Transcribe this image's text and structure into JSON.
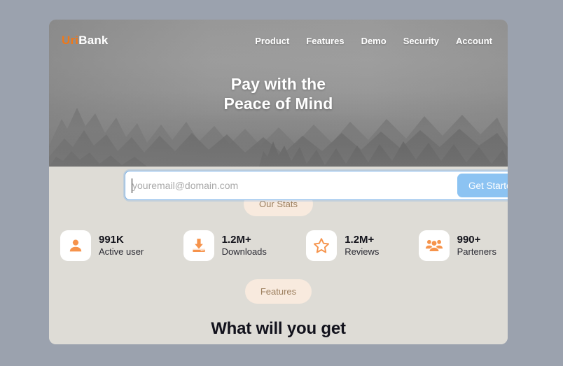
{
  "theme": {
    "page_background": "#9ba2ae",
    "card_background": "#dedcd6",
    "accent_orange": "#f07818",
    "icon_orange": "#f6934b",
    "button_blue": "#8cc3f2",
    "pill_background": "#f8eade",
    "pill_text": "#9c7f5e"
  },
  "header": {
    "logo": {
      "icon": "none",
      "part_one": "Uri",
      "part_two": "Bank",
      "full": "UriBank"
    },
    "nav": [
      {
        "label": "Product"
      },
      {
        "label": "Features"
      },
      {
        "label": "Demo"
      },
      {
        "label": "Security"
      },
      {
        "label": "Account"
      }
    ]
  },
  "hero": {
    "headline_line_1": "Pay with the",
    "headline_line_2": "Peace of Mind",
    "background_description": "grayscale misty forest photograph"
  },
  "signup": {
    "placeholder": "youremail@domain.com",
    "value": "",
    "focused": true,
    "button_label": "Get Started"
  },
  "stats_section": {
    "pill_label": "Our Stats",
    "items": [
      {
        "icon": "user-icon",
        "value": "991K",
        "label": "Active user"
      },
      {
        "icon": "download-icon",
        "value": "1.2M+",
        "label": "Downloads"
      },
      {
        "icon": "star-icon",
        "value": "1.2M+",
        "label": "Reviews"
      },
      {
        "icon": "group-icon",
        "value": "990+",
        "label": "Parteners"
      }
    ]
  },
  "features_section": {
    "pill_label": "Features",
    "title": "What will you get"
  }
}
